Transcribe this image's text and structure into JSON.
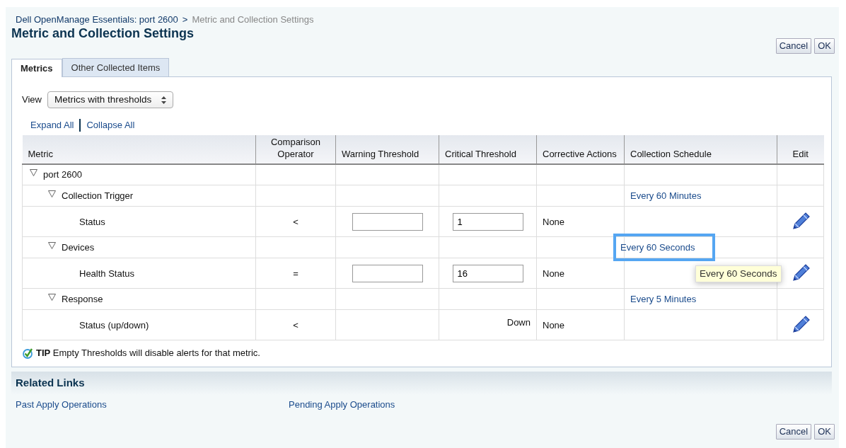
{
  "breadcrumb": {
    "parent": "Dell OpenManage Essentials: port 2600",
    "separator": ">",
    "current": "Metric and Collection Settings"
  },
  "title": "Metric and Collection Settings",
  "top_buttons": [
    "Cancel",
    "OK"
  ],
  "tabs": [
    {
      "label": "Metrics",
      "selected": true
    },
    {
      "label": "Other Collected Items",
      "selected": false
    }
  ],
  "view": {
    "label": "View",
    "value": "Metrics with thresholds"
  },
  "tree_links": [
    "Expand All",
    "Collapse All"
  ],
  "table": {
    "columns": [
      "Metric",
      "Comparison Operator",
      "Warning Threshold",
      "Critical Threshold",
      "Corrective Actions",
      "Collection Schedule",
      "Edit"
    ],
    "rows": [
      {
        "kind": "group",
        "name": "port 2600",
        "expanded": true,
        "children": [
          {
            "kind": "group",
            "name": "Collection Trigger",
            "expanded": true,
            "schedule": "Every 60 Minutes",
            "highlighted": false,
            "children": [
              {
                "kind": "metric",
                "name": "Status",
                "operator": "<",
                "warning": {
                  "kind": "field"
                },
                "critical": {
                  "kind": "field",
                  "value": "1"
                },
                "actions": "None",
                "editable": true
              }
            ]
          },
          {
            "kind": "group",
            "name": "Devices",
            "expanded": true,
            "schedule": "Every 60 Seconds",
            "highlighted": true,
            "children": [
              {
                "kind": "metric",
                "name": "Health Status",
                "operator": "=",
                "warning": {
                  "kind": "field"
                },
                "critical": {
                  "kind": "field",
                  "value": "16"
                },
                "actions": "None",
                "editable": true
              }
            ]
          },
          {
            "kind": "group",
            "name": "Response",
            "expanded": true,
            "schedule": "Every 5 Minutes",
            "highlighted": false,
            "children": [
              {
                "kind": "metric",
                "name": "Status (up/down)",
                "operator": "<",
                "critical": {
                  "kind": "text",
                  "value": "Down"
                },
                "actions": "None",
                "editable": true
              }
            ]
          }
        ]
      }
    ]
  },
  "tooltip": "Every 60 Seconds",
  "tip": {
    "label": "TIP",
    "text": "Empty Thresholds will disable alerts for that metric."
  },
  "related_links": {
    "title": "Related Links",
    "links": [
      "Past Apply Operations",
      "Pending Apply Operations"
    ]
  },
  "bottom_buttons": [
    "Cancel",
    "OK"
  ]
}
